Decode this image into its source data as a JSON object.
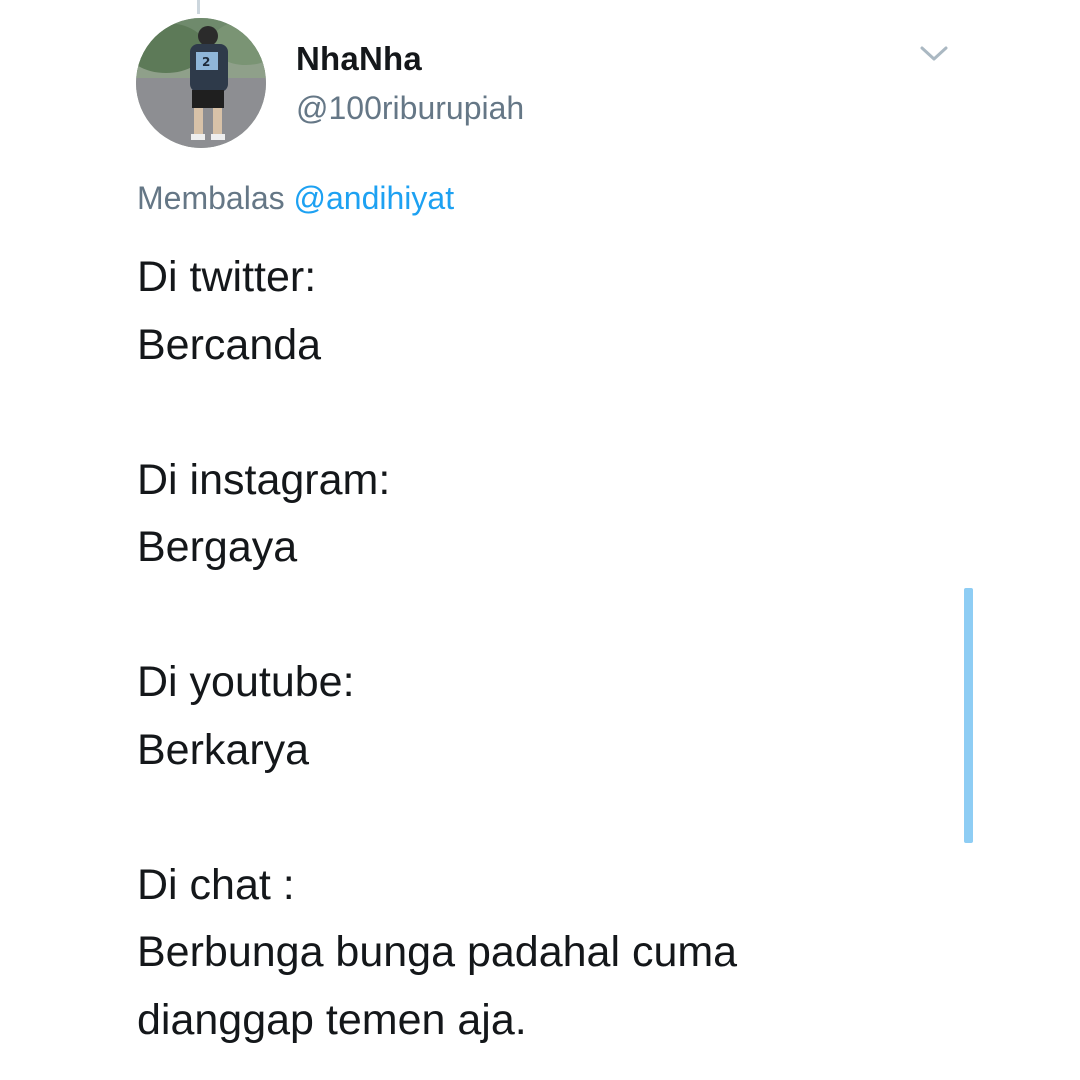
{
  "tweet": {
    "author": {
      "display_name": "NhaNha",
      "handle": "@100riburupiah",
      "avatar_jersey_number": "2"
    },
    "reply": {
      "prefix": "Membalas",
      "mention": "@andihiyat"
    },
    "lines": [
      "Di twitter:",
      "Bercanda",
      "",
      "Di instagram:",
      "Bergaya",
      "",
      "Di youtube:",
      "Berkarya",
      "",
      "Di chat :",
      "Berbunga bunga padahal cuma",
      "dianggap temen aja."
    ],
    "icons": {
      "menu": "chevron-down-icon"
    }
  },
  "colors": {
    "text": "#14171a",
    "secondary": "#657786",
    "accent": "#1da1f2",
    "scroll_indicator": "#8ecdf4"
  }
}
